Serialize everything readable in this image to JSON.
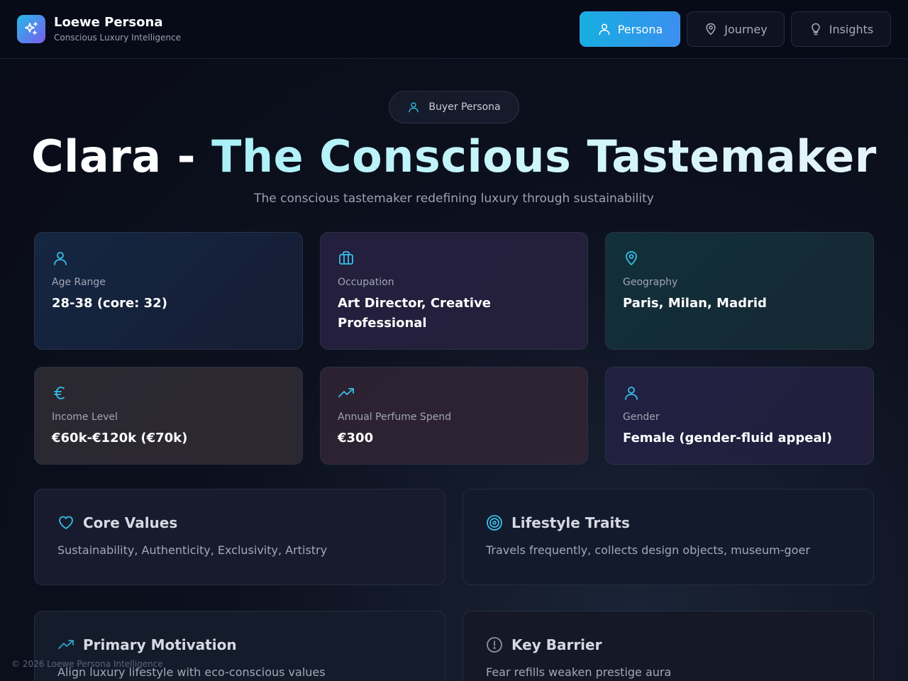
{
  "brand": {
    "title": "Loewe Persona",
    "subtitle": "Conscious Luxury Intelligence",
    "icon": "sparkles-icon"
  },
  "nav": [
    {
      "label": "Persona",
      "icon": "user-icon",
      "active": true
    },
    {
      "label": "Journey",
      "icon": "map-pin-icon",
      "active": false
    },
    {
      "label": "Insights",
      "icon": "lightbulb-icon",
      "active": false
    }
  ],
  "hero": {
    "badge": "Buyer Persona",
    "title_name": "Clara - ",
    "title_highlight": "The Conscious Tastemaker",
    "subtitle": "The conscious tastemaker redefining luxury through sustainability"
  },
  "stats": [
    {
      "label": "Age Range",
      "value": "28-38 (core: 32)",
      "icon": "user-icon"
    },
    {
      "label": "Occupation",
      "value": "Art Director, Creative Professional",
      "icon": "briefcase-icon"
    },
    {
      "label": "Geography",
      "value": "Paris, Milan, Madrid",
      "icon": "map-pin-icon"
    },
    {
      "label": "Income Level",
      "value": "€60k-€120k (€70k)",
      "icon": "euro-icon"
    },
    {
      "label": "Annual Perfume Spend",
      "value": "€300",
      "icon": "trending-up-icon"
    },
    {
      "label": "Gender",
      "value": "Female (gender-fluid appeal)",
      "icon": "user-icon"
    }
  ],
  "info": [
    {
      "title": "Core Values",
      "text": "Sustainability, Authenticity, Exclusivity, Artistry",
      "icon": "heart-icon"
    },
    {
      "title": "Lifestyle Traits",
      "text": "Travels frequently, collects design objects, museum-goer",
      "icon": "target-icon"
    },
    {
      "title": "Primary Motivation",
      "text": "Align luxury lifestyle with eco-conscious values",
      "icon": "trending-up-icon"
    },
    {
      "title": "Key Barrier",
      "text": "Fear refills weaken prestige aura",
      "icon": "alert-circle-icon"
    }
  ],
  "footer": "© 2026 Loewe Persona Intelligence",
  "colors": {
    "accent": "#25b9e6",
    "accent_gradient_end": "#7b5cf0",
    "icon_cyan": "#38bfe8"
  }
}
